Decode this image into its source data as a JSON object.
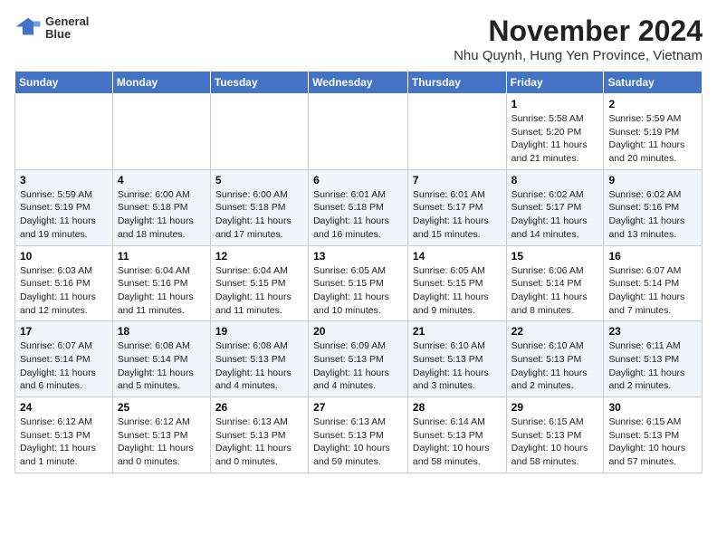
{
  "header": {
    "logo_line1": "General",
    "logo_line2": "Blue",
    "month_title": "November 2024",
    "location": "Nhu Quynh, Hung Yen Province, Vietnam"
  },
  "days_of_week": [
    "Sunday",
    "Monday",
    "Tuesday",
    "Wednesday",
    "Thursday",
    "Friday",
    "Saturday"
  ],
  "weeks": [
    [
      {
        "day": "",
        "info": ""
      },
      {
        "day": "",
        "info": ""
      },
      {
        "day": "",
        "info": ""
      },
      {
        "day": "",
        "info": ""
      },
      {
        "day": "",
        "info": ""
      },
      {
        "day": "1",
        "info": "Sunrise: 5:58 AM\nSunset: 5:20 PM\nDaylight: 11 hours\nand 21 minutes."
      },
      {
        "day": "2",
        "info": "Sunrise: 5:59 AM\nSunset: 5:19 PM\nDaylight: 11 hours\nand 20 minutes."
      }
    ],
    [
      {
        "day": "3",
        "info": "Sunrise: 5:59 AM\nSunset: 5:19 PM\nDaylight: 11 hours\nand 19 minutes."
      },
      {
        "day": "4",
        "info": "Sunrise: 6:00 AM\nSunset: 5:18 PM\nDaylight: 11 hours\nand 18 minutes."
      },
      {
        "day": "5",
        "info": "Sunrise: 6:00 AM\nSunset: 5:18 PM\nDaylight: 11 hours\nand 17 minutes."
      },
      {
        "day": "6",
        "info": "Sunrise: 6:01 AM\nSunset: 5:18 PM\nDaylight: 11 hours\nand 16 minutes."
      },
      {
        "day": "7",
        "info": "Sunrise: 6:01 AM\nSunset: 5:17 PM\nDaylight: 11 hours\nand 15 minutes."
      },
      {
        "day": "8",
        "info": "Sunrise: 6:02 AM\nSunset: 5:17 PM\nDaylight: 11 hours\nand 14 minutes."
      },
      {
        "day": "9",
        "info": "Sunrise: 6:02 AM\nSunset: 5:16 PM\nDaylight: 11 hours\nand 13 minutes."
      }
    ],
    [
      {
        "day": "10",
        "info": "Sunrise: 6:03 AM\nSunset: 5:16 PM\nDaylight: 11 hours\nand 12 minutes."
      },
      {
        "day": "11",
        "info": "Sunrise: 6:04 AM\nSunset: 5:16 PM\nDaylight: 11 hours\nand 11 minutes."
      },
      {
        "day": "12",
        "info": "Sunrise: 6:04 AM\nSunset: 5:15 PM\nDaylight: 11 hours\nand 11 minutes."
      },
      {
        "day": "13",
        "info": "Sunrise: 6:05 AM\nSunset: 5:15 PM\nDaylight: 11 hours\nand 10 minutes."
      },
      {
        "day": "14",
        "info": "Sunrise: 6:05 AM\nSunset: 5:15 PM\nDaylight: 11 hours\nand 9 minutes."
      },
      {
        "day": "15",
        "info": "Sunrise: 6:06 AM\nSunset: 5:14 PM\nDaylight: 11 hours\nand 8 minutes."
      },
      {
        "day": "16",
        "info": "Sunrise: 6:07 AM\nSunset: 5:14 PM\nDaylight: 11 hours\nand 7 minutes."
      }
    ],
    [
      {
        "day": "17",
        "info": "Sunrise: 6:07 AM\nSunset: 5:14 PM\nDaylight: 11 hours\nand 6 minutes."
      },
      {
        "day": "18",
        "info": "Sunrise: 6:08 AM\nSunset: 5:14 PM\nDaylight: 11 hours\nand 5 minutes."
      },
      {
        "day": "19",
        "info": "Sunrise: 6:08 AM\nSunset: 5:13 PM\nDaylight: 11 hours\nand 4 minutes."
      },
      {
        "day": "20",
        "info": "Sunrise: 6:09 AM\nSunset: 5:13 PM\nDaylight: 11 hours\nand 4 minutes."
      },
      {
        "day": "21",
        "info": "Sunrise: 6:10 AM\nSunset: 5:13 PM\nDaylight: 11 hours\nand 3 minutes."
      },
      {
        "day": "22",
        "info": "Sunrise: 6:10 AM\nSunset: 5:13 PM\nDaylight: 11 hours\nand 2 minutes."
      },
      {
        "day": "23",
        "info": "Sunrise: 6:11 AM\nSunset: 5:13 PM\nDaylight: 11 hours\nand 2 minutes."
      }
    ],
    [
      {
        "day": "24",
        "info": "Sunrise: 6:12 AM\nSunset: 5:13 PM\nDaylight: 11 hours\nand 1 minute."
      },
      {
        "day": "25",
        "info": "Sunrise: 6:12 AM\nSunset: 5:13 PM\nDaylight: 11 hours\nand 0 minutes."
      },
      {
        "day": "26",
        "info": "Sunrise: 6:13 AM\nSunset: 5:13 PM\nDaylight: 11 hours\nand 0 minutes."
      },
      {
        "day": "27",
        "info": "Sunrise: 6:13 AM\nSunset: 5:13 PM\nDaylight: 10 hours\nand 59 minutes."
      },
      {
        "day": "28",
        "info": "Sunrise: 6:14 AM\nSunset: 5:13 PM\nDaylight: 10 hours\nand 58 minutes."
      },
      {
        "day": "29",
        "info": "Sunrise: 6:15 AM\nSunset: 5:13 PM\nDaylight: 10 hours\nand 58 minutes."
      },
      {
        "day": "30",
        "info": "Sunrise: 6:15 AM\nSunset: 5:13 PM\nDaylight: 10 hours\nand 57 minutes."
      }
    ]
  ]
}
